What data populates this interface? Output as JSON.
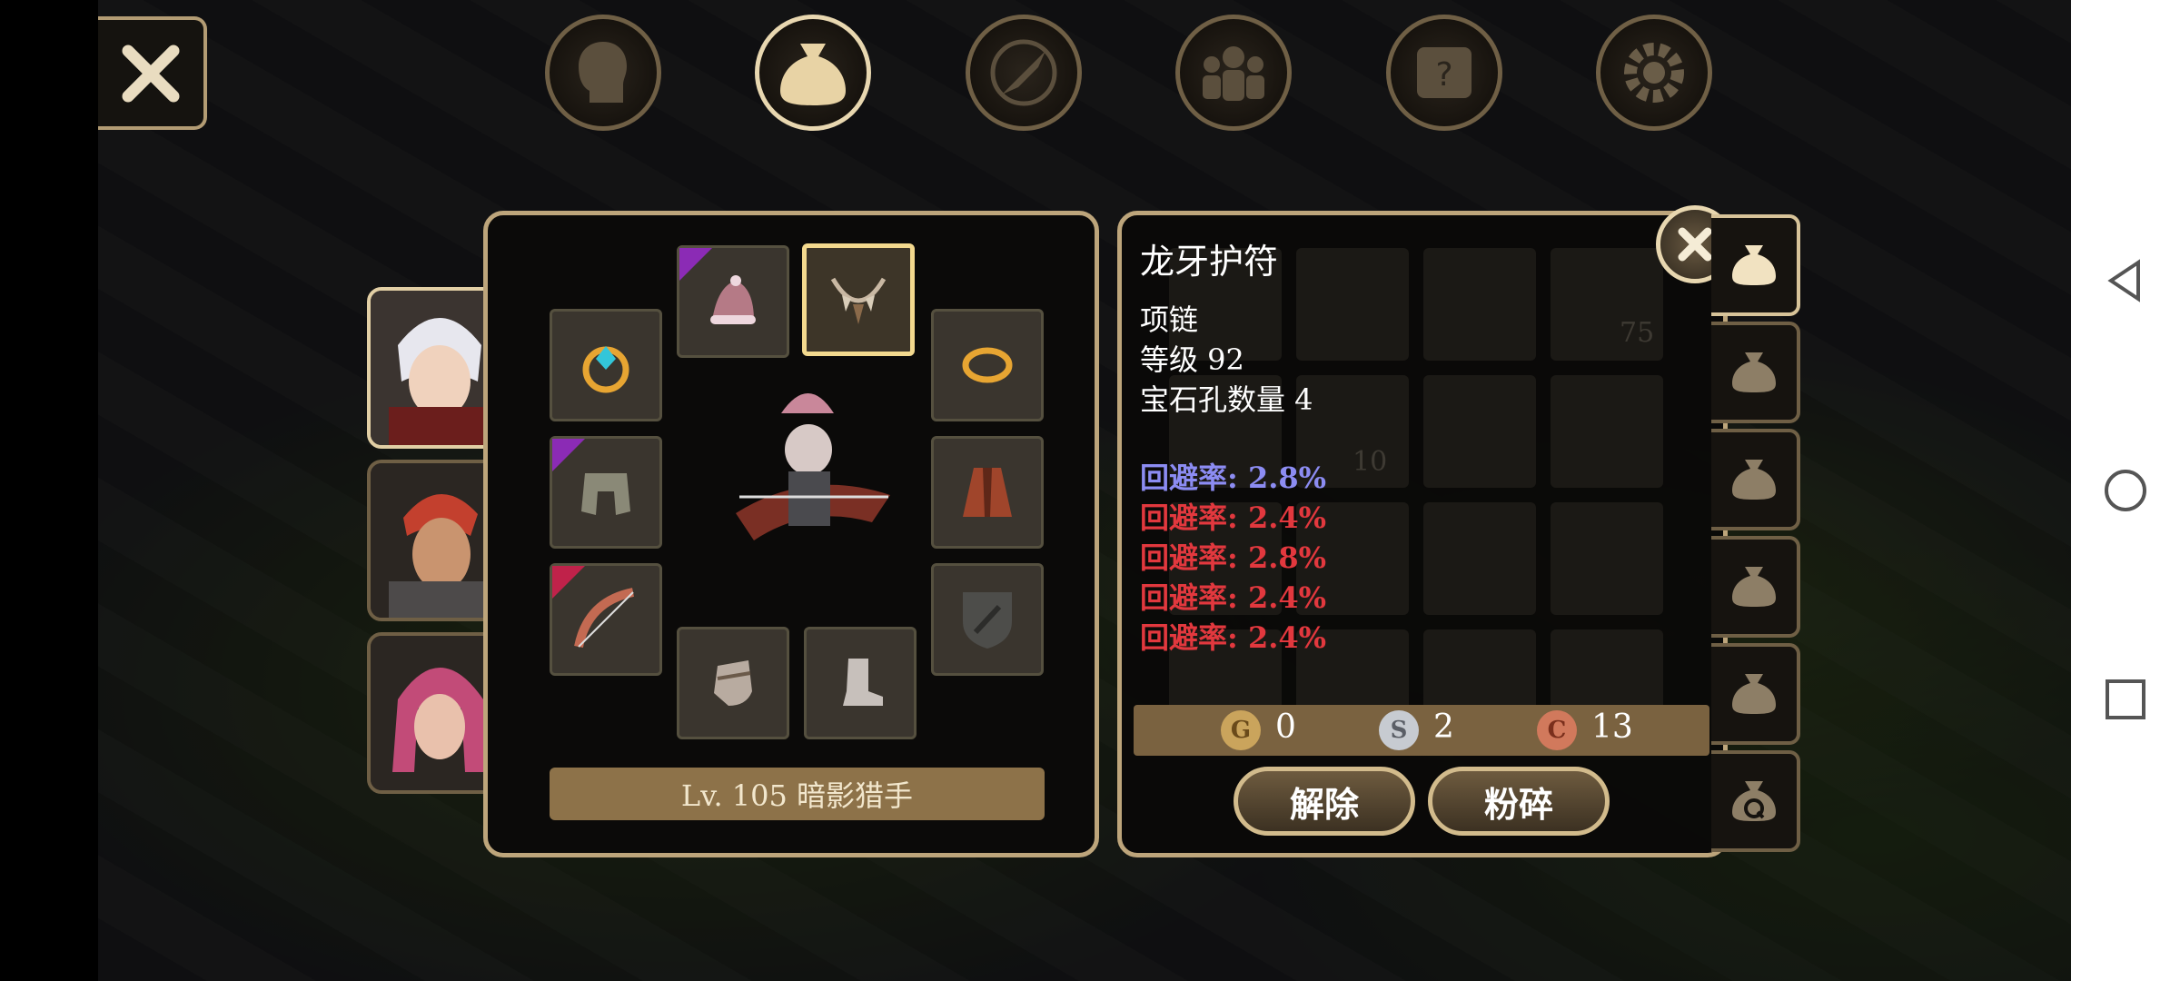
{
  "character": {
    "level_label": "Lv. 105 暗影猎手"
  },
  "item": {
    "name": "龙牙护符",
    "type": "项链",
    "level": "等级 92",
    "gem_slots": "宝石孔数量 4",
    "stats": [
      {
        "text": "回避率: 2.8%",
        "color": "#8c8cf2"
      },
      {
        "text": "回避率: 2.4%",
        "color": "#e2383e"
      },
      {
        "text": "回避率: 2.8%",
        "color": "#e2383e"
      },
      {
        "text": "回避率: 2.4%",
        "color": "#e2383e"
      },
      {
        "text": "回避率: 2.4%",
        "color": "#e2383e"
      }
    ]
  },
  "currency": {
    "gold": "0",
    "silver": "2",
    "copper": "13",
    "gold_glyph": "G",
    "silver_glyph": "S",
    "copper_glyph": "C"
  },
  "buttons": {
    "unequip": "解除",
    "crush": "粉碎"
  },
  "background_inventory": {
    "stack_count_a": "10",
    "stack_count_b": "75"
  },
  "top_menu": [
    "character-icon",
    "bag-icon",
    "compass-sword-icon",
    "party-icon",
    "quest-scroll-icon",
    "settings-gear-icon"
  ],
  "colors": {
    "frame": "#bda57b",
    "slot": "#3a352e",
    "epic": "#8b2bb5",
    "legendary": "#c0224a"
  }
}
